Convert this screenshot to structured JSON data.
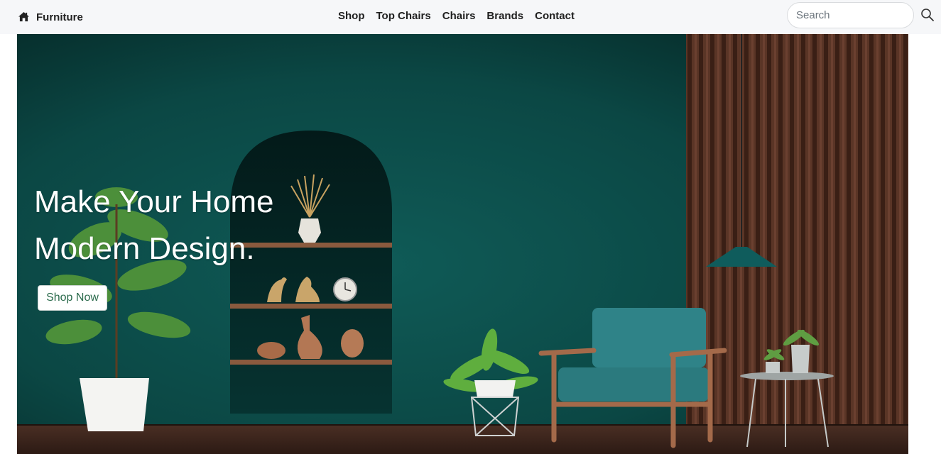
{
  "navbar": {
    "brand_icon": "home-icon",
    "brand_label": "Furniture",
    "links": [
      {
        "label": "Shop"
      },
      {
        "label": "Top Chairs"
      },
      {
        "label": "Chairs"
      },
      {
        "label": "Brands"
      },
      {
        "label": "Contact"
      }
    ],
    "search": {
      "placeholder": "Search",
      "value": "",
      "icon": "search-icon"
    }
  },
  "hero": {
    "title_line1": "Make Your Home",
    "title_line2": "Modern Design.",
    "cta_label": "Shop Now"
  },
  "colors": {
    "navbar_bg": "#f6f7f9",
    "hero_wall": "#0d4a48",
    "wood_panel": "#4a2c1f",
    "floor": "#3a241c",
    "chair_cushion": "#2d7f82",
    "cta_text": "#2b6b4c"
  }
}
